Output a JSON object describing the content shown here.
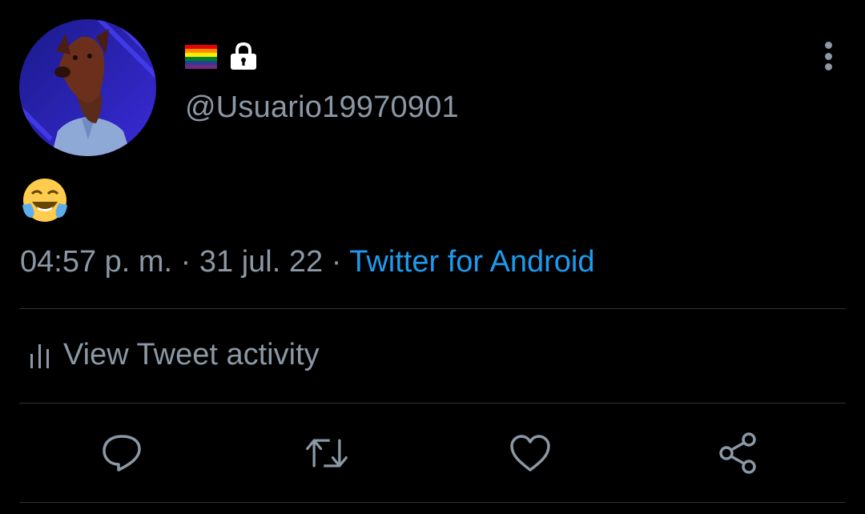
{
  "tweet": {
    "handle": "@Usuario19970901",
    "text_emoji": "😂",
    "time": "04:57 p. m.",
    "separator": " · ",
    "date": "31 jul. 22",
    "source": "Twitter for Android"
  },
  "activity": {
    "label": "View Tweet activity"
  },
  "icons": {
    "flag": "rainbow-flag-icon",
    "lock": "lock-icon",
    "more": "more-vertical-icon",
    "reply": "reply-icon",
    "retweet": "retweet-icon",
    "like": "heart-icon",
    "share": "share-icon",
    "activity": "bar-chart-icon"
  },
  "colors": {
    "background": "#000000",
    "secondary_text": "#8b98a5",
    "link": "#1d9bf0",
    "divider": "#2f3336"
  }
}
